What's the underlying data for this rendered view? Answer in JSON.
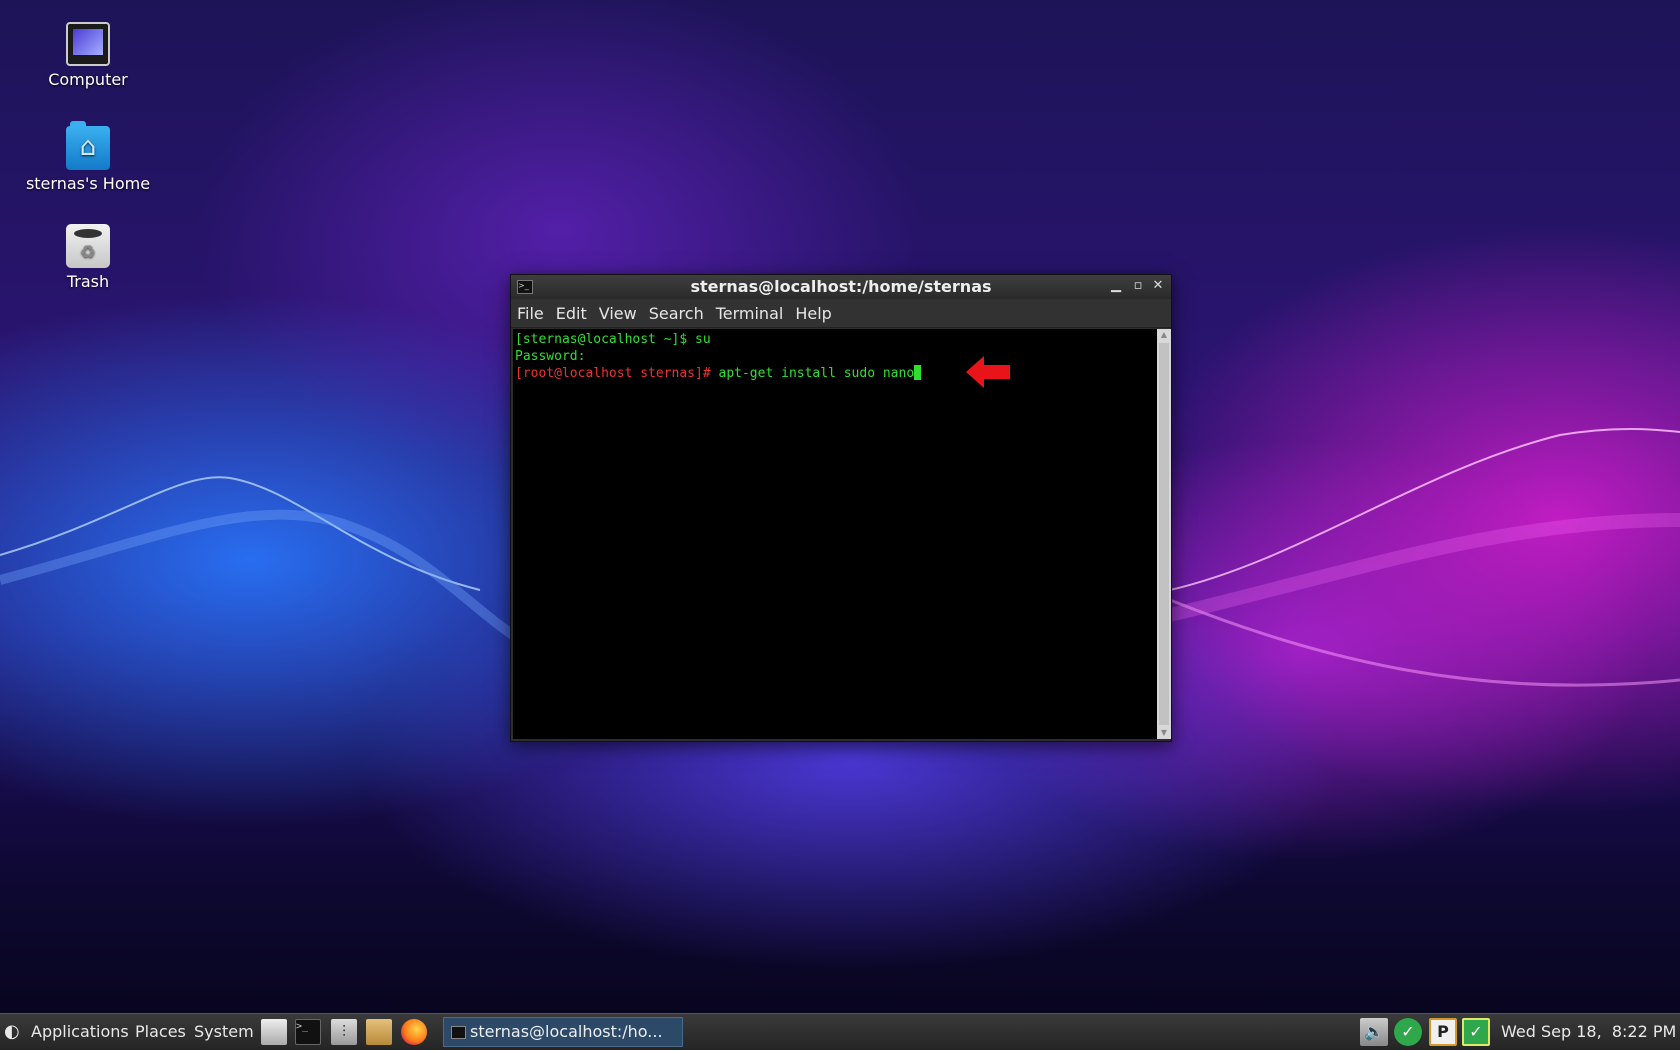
{
  "desktop": {
    "icons": [
      {
        "label": "Computer"
      },
      {
        "label": "sternas's Home"
      },
      {
        "label": "Trash"
      }
    ]
  },
  "terminal": {
    "title": "sternas@localhost:/home/sternas",
    "menu": [
      "File",
      "Edit",
      "View",
      "Search",
      "Terminal",
      "Help"
    ],
    "line1": "[sternas@localhost ~]$ su",
    "line2": "Password:",
    "prompt3": "[root@localhost sternas]#",
    "command3": " apt-get install sudo nano"
  },
  "annotation": {
    "arrow_color": "#e8141a"
  },
  "taskbar": {
    "menus": [
      "Applications",
      "Places",
      "System"
    ],
    "launchers": [
      "file-manager-icon",
      "terminal-icon",
      "settings-icon",
      "archive-icon",
      "firefox-icon"
    ],
    "task_label": "sternas@localhost:/ho...",
    "clock": "Wed Sep 18,  8:22 PM",
    "tray": [
      "volume-icon",
      "update-check-icon",
      "clipboard-icon",
      "checkmark-icon"
    ]
  }
}
